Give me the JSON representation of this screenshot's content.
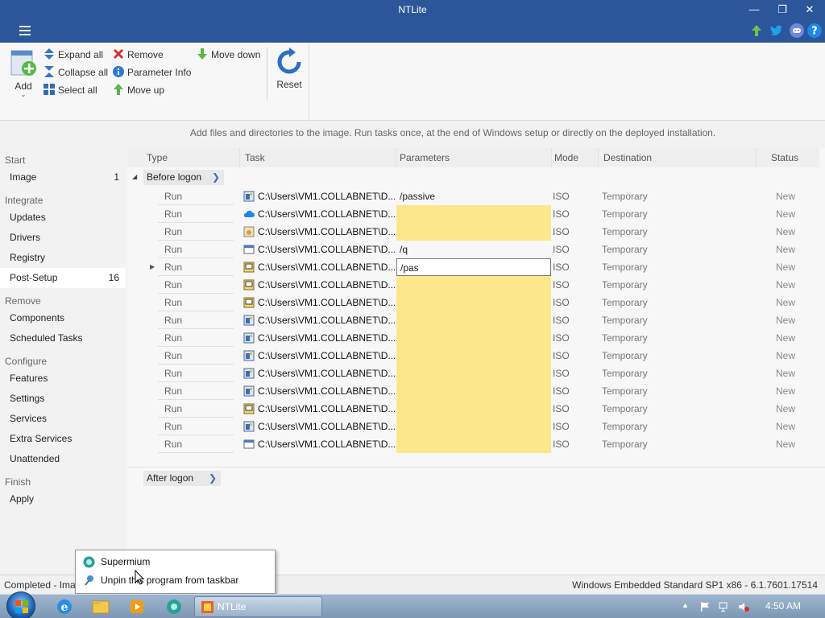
{
  "window": {
    "title": "NTLite"
  },
  "ribbon": {
    "add": "Add",
    "expand_all": "Expand all",
    "collapse_all": "Collapse all",
    "select_all": "Select all",
    "remove": "Remove",
    "parameter_info": "Parameter Info",
    "move_up": "Move up",
    "move_down": "Move down",
    "reset": "Reset"
  },
  "hint": "Add files and directories to the image. Run tasks once, at the end of Windows setup or directly on the deployed installation.",
  "sidebar": {
    "start": "Start",
    "image": "Image",
    "image_count": "1",
    "integrate": "Integrate",
    "updates": "Updates",
    "drivers": "Drivers",
    "registry": "Registry",
    "post_setup": "Post-Setup",
    "post_setup_count": "16",
    "remove": "Remove",
    "components": "Components",
    "scheduled_tasks": "Scheduled Tasks",
    "configure": "Configure",
    "features": "Features",
    "settings": "Settings",
    "services": "Services",
    "extra_services": "Extra Services",
    "unattended": "Unattended",
    "finish": "Finish",
    "apply": "Apply"
  },
  "table": {
    "columns": {
      "type": "Type",
      "task": "Task",
      "parameters": "Parameters",
      "mode": "Mode",
      "destination": "Destination",
      "status": "Status"
    },
    "group_before": "Before logon",
    "group_after": "After logon",
    "rows": [
      {
        "type": "Run",
        "task": "C:\\Users\\VM1.COLLABNET\\D...",
        "param": "/passive",
        "mode": "ISO",
        "dest": "Temporary",
        "status": "New"
      },
      {
        "type": "Run",
        "task": "C:\\Users\\VM1.COLLABNET\\D...",
        "param": "",
        "mode": "ISO",
        "dest": "Temporary",
        "status": "New"
      },
      {
        "type": "Run",
        "task": "C:\\Users\\VM1.COLLABNET\\D...",
        "param": "",
        "mode": "ISO",
        "dest": "Temporary",
        "status": "New"
      },
      {
        "type": "Run",
        "task": "C:\\Users\\VM1.COLLABNET\\D...",
        "param": "/q",
        "mode": "ISO",
        "dest": "Temporary",
        "status": "New"
      },
      {
        "type": "Run",
        "task": "C:\\Users\\VM1.COLLABNET\\D...",
        "param": "/pas",
        "mode": "ISO",
        "dest": "Temporary",
        "status": "New"
      },
      {
        "type": "Run",
        "task": "C:\\Users\\VM1.COLLABNET\\D...",
        "param": "",
        "mode": "ISO",
        "dest": "Temporary",
        "status": "New"
      },
      {
        "type": "Run",
        "task": "C:\\Users\\VM1.COLLABNET\\D...",
        "param": "",
        "mode": "ISO",
        "dest": "Temporary",
        "status": "New"
      },
      {
        "type": "Run",
        "task": "C:\\Users\\VM1.COLLABNET\\D...",
        "param": "",
        "mode": "ISO",
        "dest": "Temporary",
        "status": "New"
      },
      {
        "type": "Run",
        "task": "C:\\Users\\VM1.COLLABNET\\D...",
        "param": "",
        "mode": "ISO",
        "dest": "Temporary",
        "status": "New"
      },
      {
        "type": "Run",
        "task": "C:\\Users\\VM1.COLLABNET\\D...",
        "param": "",
        "mode": "ISO",
        "dest": "Temporary",
        "status": "New"
      },
      {
        "type": "Run",
        "task": "C:\\Users\\VM1.COLLABNET\\D...",
        "param": "",
        "mode": "ISO",
        "dest": "Temporary",
        "status": "New"
      },
      {
        "type": "Run",
        "task": "C:\\Users\\VM1.COLLABNET\\D...",
        "param": "",
        "mode": "ISO",
        "dest": "Temporary",
        "status": "New"
      },
      {
        "type": "Run",
        "task": "C:\\Users\\VM1.COLLABNET\\D...",
        "param": "",
        "mode": "ISO",
        "dest": "Temporary",
        "status": "New"
      },
      {
        "type": "Run",
        "task": "C:\\Users\\VM1.COLLABNET\\D...",
        "param": "",
        "mode": "ISO",
        "dest": "Temporary",
        "status": "New"
      },
      {
        "type": "Run",
        "task": "C:\\Users\\VM1.COLLABNET\\D...",
        "param": "",
        "mode": "ISO",
        "dest": "Temporary",
        "status": "New"
      }
    ]
  },
  "statusbar": {
    "left": "Completed - Ima",
    "right": "Windows Embedded Standard SP1 x86 - 6.1.7601.17514"
  },
  "context_menu": {
    "item1": "Supermium",
    "item2": "Unpin this program from taskbar"
  },
  "taskbar": {
    "app_label": "NTLite",
    "clock": "4:50 AM"
  },
  "colors": {
    "titlebar": "#2b579a",
    "empty_param": "#fde78c"
  }
}
